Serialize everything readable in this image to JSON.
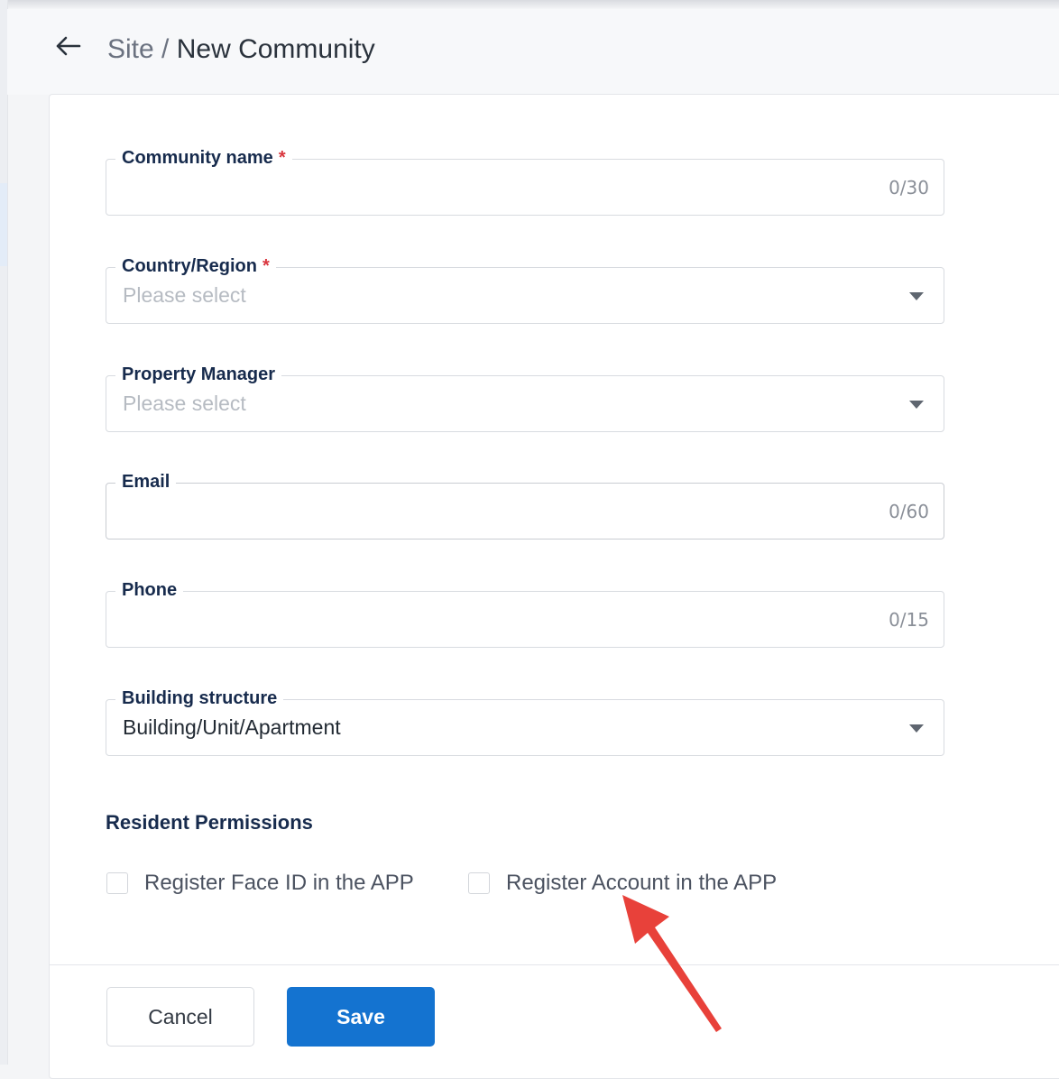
{
  "breadcrumb": {
    "parent": "Site",
    "separator": " / ",
    "current": "New Community"
  },
  "fields": {
    "community_name": {
      "label": "Community name",
      "required_mark": "*",
      "counter": "0/30"
    },
    "country_region": {
      "label": "Country/Region",
      "required_mark": "*",
      "placeholder": "Please select"
    },
    "property_manager": {
      "label": "Property Manager",
      "placeholder": "Please select"
    },
    "email": {
      "label": "Email",
      "counter": "0/60"
    },
    "phone": {
      "label": "Phone",
      "counter": "0/15"
    },
    "building_structure": {
      "label": "Building structure",
      "value": "Building/Unit/Apartment"
    }
  },
  "permissions": {
    "title": "Resident Permissions",
    "options": [
      {
        "label": "Register Face ID in the APP",
        "checked": false
      },
      {
        "label": "Register Account in the APP",
        "checked": false
      }
    ]
  },
  "actions": {
    "cancel_label": "Cancel",
    "save_label": "Save"
  },
  "colors": {
    "primary": "#1473d0",
    "required": "#d9363e",
    "annotation_arrow": "#e8413a"
  },
  "icons": {
    "back": "arrow-left-icon",
    "dropdown": "caret-down-icon",
    "annotation": "red-arrow-pointer"
  }
}
